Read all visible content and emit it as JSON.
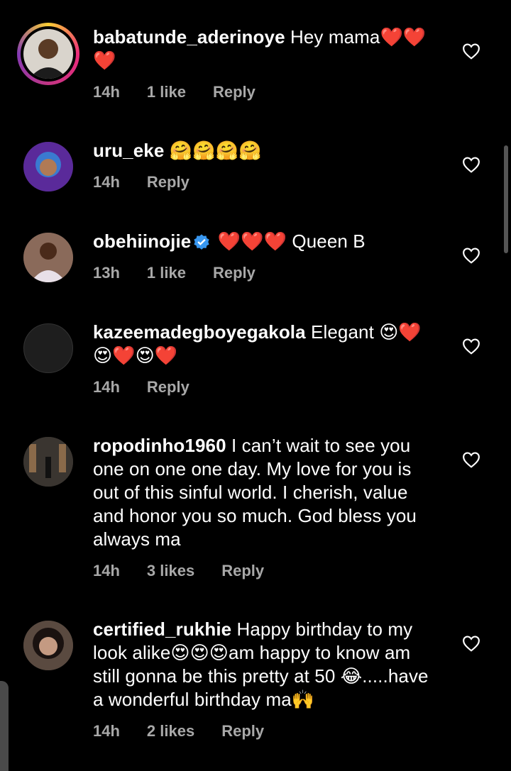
{
  "comments": [
    {
      "username": "babatunde_aderinoye",
      "text": " Hey mama❤️❤️❤️",
      "time": "14h",
      "likes": "1 like",
      "reply": "Reply",
      "story_ring": true,
      "verified": false,
      "avatar": "profile-photo"
    },
    {
      "username": "uru_eke",
      "text": " 🤗🤗🤗🤗",
      "time": "14h",
      "likes": "",
      "reply": "Reply",
      "story_ring": false,
      "verified": false,
      "avatar": "profile-photo"
    },
    {
      "username": "obehiinojie",
      "text": " ❤️❤️❤️ Queen B",
      "time": "13h",
      "likes": "1 like",
      "reply": "Reply",
      "story_ring": false,
      "verified": true,
      "avatar": "profile-photo"
    },
    {
      "username": "kazeemadegboyegakola",
      "text": " Elegant 😍❤️😍❤️😍❤️",
      "time": "14h",
      "likes": "",
      "reply": "Reply",
      "story_ring": false,
      "verified": false,
      "avatar": "default-avatar"
    },
    {
      "username": "ropodinho1960",
      "text": " I can’t wait to see you one on one one day. My love for you is out of this sinful world. I cherish, value and honor you so much. God bless you always ma",
      "time": "14h",
      "likes": "3 likes",
      "reply": "Reply",
      "story_ring": false,
      "verified": false,
      "avatar": "profile-photo"
    },
    {
      "username": "certified_rukhie",
      "text": " Happy birthday to my look alike😍😍😍am happy to know am still gonna be this pretty at 50 😂.....have a wonderful birthday ma🙌",
      "time": "14h",
      "likes": "2 likes",
      "reply": "Reply",
      "story_ring": false,
      "verified": false,
      "avatar": "profile-photo"
    }
  ],
  "colors": {
    "background": "#000000",
    "text": "#ffffff",
    "meta": "#a8a8a8",
    "verified": "#3897f0"
  },
  "icons": {
    "like": "heart-outline-icon",
    "verified": "verified-badge-icon"
  }
}
